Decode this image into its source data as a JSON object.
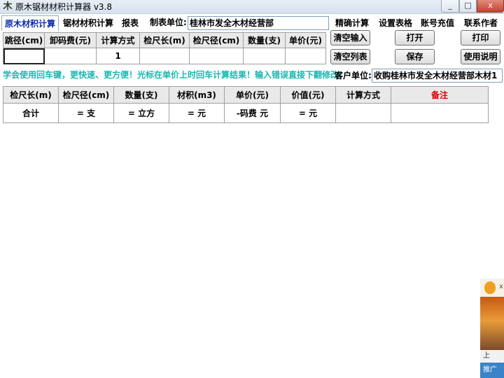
{
  "window": {
    "title": "原木锯材材积计算器 v3.8",
    "min": "_",
    "max": "□",
    "close": "x"
  },
  "tabs": [
    "原木材积计算",
    "锯材材积计算",
    "报表"
  ],
  "maker": {
    "label": "制表单位:",
    "value": "桂林市发全木材经营部"
  },
  "menu": [
    "精确计算",
    "设置表格",
    "账号充值",
    "联系作者"
  ],
  "buttons": {
    "clear_input": "清空输入",
    "clear_list": "清空列表",
    "open": "打开",
    "save": "保存",
    "print": "打印",
    "help": "使用说明"
  },
  "input_grid": {
    "headers": [
      "跳径(cm)",
      "卸码费(元)",
      "计算方式",
      "检尺长(m)",
      "检尺径(cm)",
      "数量(支)",
      "单价(元)"
    ],
    "row": [
      "",
      "",
      "1",
      "",
      "",
      "",
      ""
    ]
  },
  "hint": "学会使用回车键，更快速、更方便！光标在单价上时回车计算结果！输入错误直接下翻修改！",
  "customer": {
    "label": "客户单位:",
    "value": "收购桂林市发全木材经营部木材1"
  },
  "result_grid": {
    "headers": [
      "检尺长(m)",
      "检尺径(cm)",
      "数量(支)",
      "材积(m3)",
      "单价(元)",
      "价值(元)",
      "计算方式",
      "备注"
    ],
    "total_row": [
      "合计",
      "= 支",
      "= 立方",
      "= 元",
      "-码费 元",
      "= 元",
      "",
      ""
    ]
  },
  "qq_widget": {
    "close": "x",
    "bar": "上",
    "foot": "推广"
  },
  "colors": {
    "hint": "#18b7b0",
    "note_header": "#d40000",
    "active_tab": "#0a2aa8"
  }
}
